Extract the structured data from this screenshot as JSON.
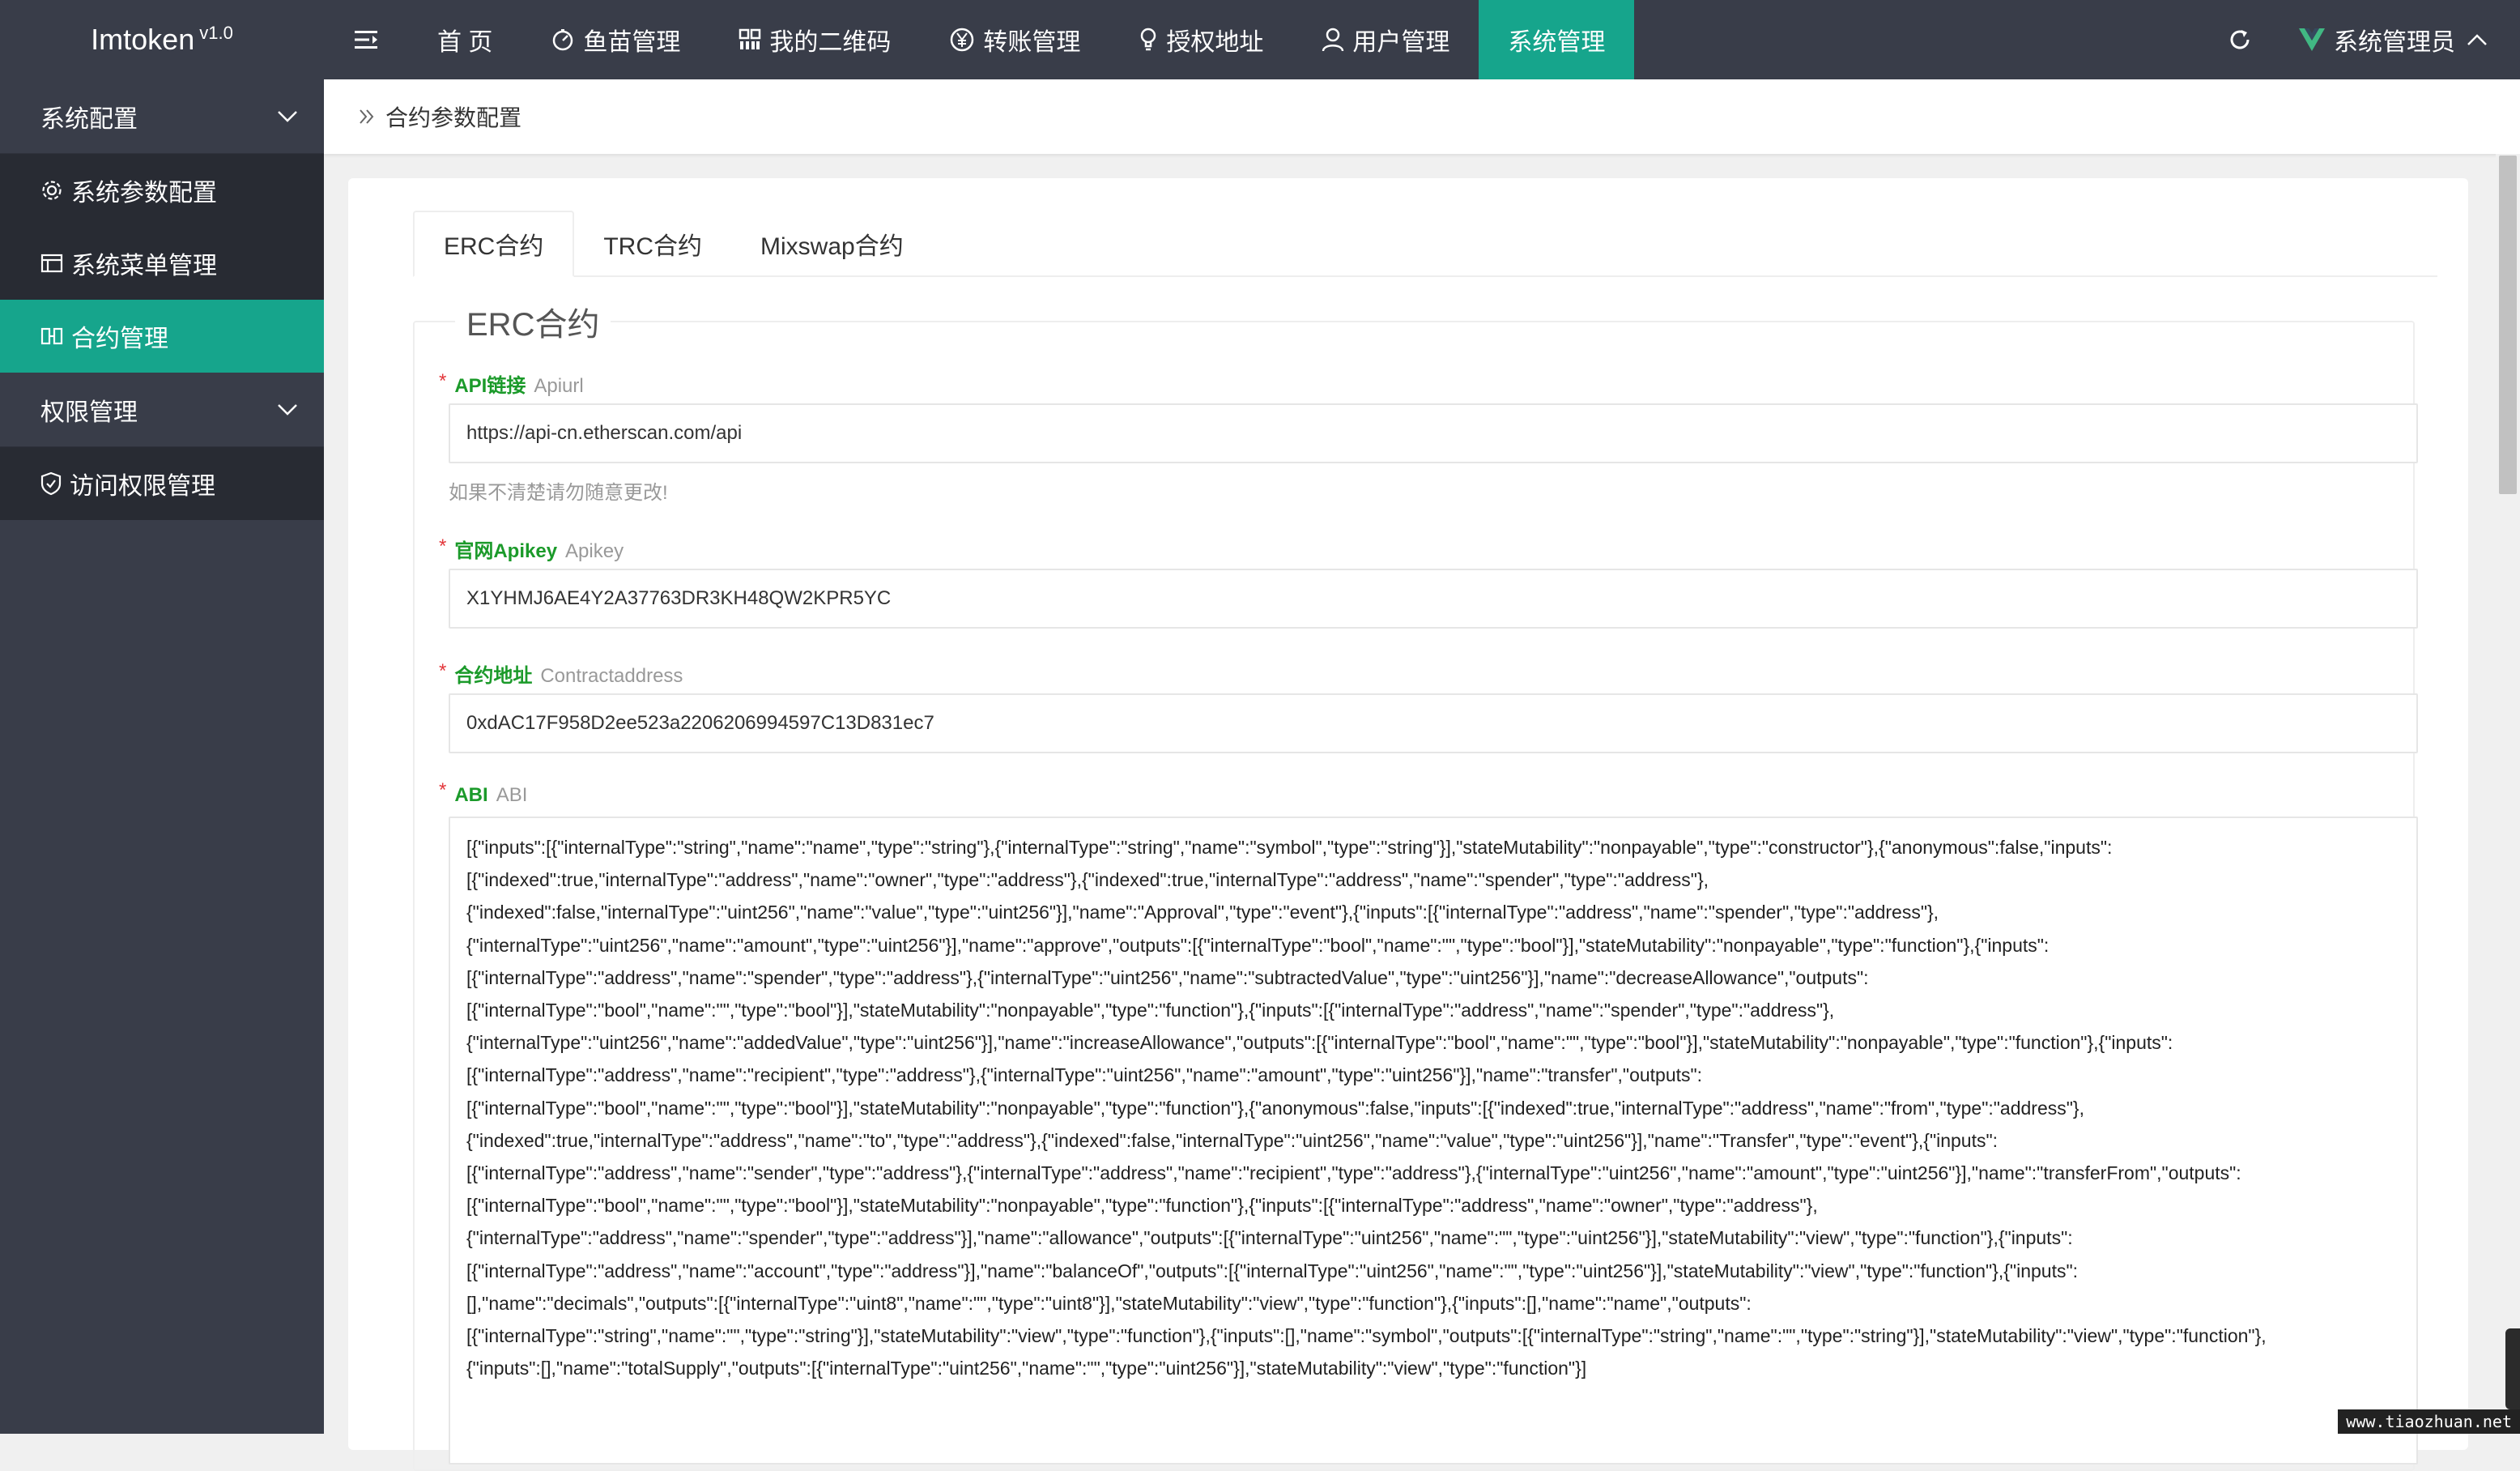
{
  "app": {
    "name": "Imtoken",
    "version": "v1.0"
  },
  "nav": {
    "items": [
      {
        "label": "首 页",
        "icon": ""
      },
      {
        "label": "鱼苗管理",
        "icon": "gauge-icon"
      },
      {
        "label": "我的二维码",
        "icon": "qrcode-icon"
      },
      {
        "label": "转账管理",
        "icon": "yen-icon"
      },
      {
        "label": "授权地址",
        "icon": "bulb-icon"
      },
      {
        "label": "用户管理",
        "icon": "user-icon"
      },
      {
        "label": "系统管理",
        "icon": ""
      }
    ],
    "active_index": 6
  },
  "user": {
    "name": "系统管理员"
  },
  "colors": {
    "accent": "#16a58c",
    "dark": "#393d49",
    "darker": "#282b33"
  },
  "sidebar": {
    "group1": {
      "label": "系统配置"
    },
    "items1": [
      {
        "label": "系统参数配置",
        "icon": "gear-icon"
      },
      {
        "label": "系统菜单管理",
        "icon": "menu-table-icon"
      },
      {
        "label": "合约管理",
        "icon": "contract-icon"
      }
    ],
    "group2": {
      "label": "权限管理"
    },
    "items2": [
      {
        "label": "访问权限管理",
        "icon": "shield-icon"
      }
    ]
  },
  "breadcrumb": {
    "title": "合约参数配置"
  },
  "tabs": [
    {
      "label": "ERC合约"
    },
    {
      "label": "TRC合约"
    },
    {
      "label": "Mixswap合约"
    }
  ],
  "form": {
    "legend": "ERC合约",
    "api": {
      "label_cn": "API链接",
      "label_en": "Apiurl",
      "value": "https://api-cn.etherscan.com/api",
      "hint": "如果不清楚请勿随意更改!"
    },
    "apikey": {
      "label_cn": "官网Apikey",
      "label_en": "Apikey",
      "value": "X1YHMJ6AE4Y2A37763DR3KH48QW2KPR5YC"
    },
    "contract": {
      "label_cn": "合约地址",
      "label_en": "Contractaddress",
      "value": "0xdAC17F958D2ee523a2206206994597C13D831ec7"
    },
    "abi": {
      "label_cn": "ABI",
      "label_en": "ABI",
      "lines": [
        "[{\"inputs\":[{\"internalType\":\"string\",\"name\":\"name\",\"type\":\"string\"},{\"internalType\":\"string\",\"name\":\"symbol\",\"type\":\"string\"}],\"stateMutability\":\"nonpayable\",\"type\":\"constructor\"},{\"anonymous\":false,\"inputs\":",
        "[{\"indexed\":true,\"internalType\":\"address\",\"name\":\"owner\",\"type\":\"address\"},{\"indexed\":true,\"internalType\":\"address\",\"name\":\"spender\",\"type\":\"address\"},",
        "{\"indexed\":false,\"internalType\":\"uint256\",\"name\":\"value\",\"type\":\"uint256\"}],\"name\":\"Approval\",\"type\":\"event\"},{\"inputs\":[{\"internalType\":\"address\",\"name\":\"spender\",\"type\":\"address\"},",
        "{\"internalType\":\"uint256\",\"name\":\"amount\",\"type\":\"uint256\"}],\"name\":\"approve\",\"outputs\":[{\"internalType\":\"bool\",\"name\":\"\",\"type\":\"bool\"}],\"stateMutability\":\"nonpayable\",\"type\":\"function\"},{\"inputs\":",
        "[{\"internalType\":\"address\",\"name\":\"spender\",\"type\":\"address\"},{\"internalType\":\"uint256\",\"name\":\"subtractedValue\",\"type\":\"uint256\"}],\"name\":\"decreaseAllowance\",\"outputs\":",
        "[{\"internalType\":\"bool\",\"name\":\"\",\"type\":\"bool\"}],\"stateMutability\":\"nonpayable\",\"type\":\"function\"},{\"inputs\":[{\"internalType\":\"address\",\"name\":\"spender\",\"type\":\"address\"},",
        "{\"internalType\":\"uint256\",\"name\":\"addedValue\",\"type\":\"uint256\"}],\"name\":\"increaseAllowance\",\"outputs\":[{\"internalType\":\"bool\",\"name\":\"\",\"type\":\"bool\"}],\"stateMutability\":\"nonpayable\",\"type\":\"function\"},{\"inputs\":",
        "[{\"internalType\":\"address\",\"name\":\"recipient\",\"type\":\"address\"},{\"internalType\":\"uint256\",\"name\":\"amount\",\"type\":\"uint256\"}],\"name\":\"transfer\",\"outputs\":",
        "[{\"internalType\":\"bool\",\"name\":\"\",\"type\":\"bool\"}],\"stateMutability\":\"nonpayable\",\"type\":\"function\"},{\"anonymous\":false,\"inputs\":[{\"indexed\":true,\"internalType\":\"address\",\"name\":\"from\",\"type\":\"address\"},",
        "{\"indexed\":true,\"internalType\":\"address\",\"name\":\"to\",\"type\":\"address\"},{\"indexed\":false,\"internalType\":\"uint256\",\"name\":\"value\",\"type\":\"uint256\"}],\"name\":\"Transfer\",\"type\":\"event\"},{\"inputs\":",
        "[{\"internalType\":\"address\",\"name\":\"sender\",\"type\":\"address\"},{\"internalType\":\"address\",\"name\":\"recipient\",\"type\":\"address\"},{\"internalType\":\"uint256\",\"name\":\"amount\",\"type\":\"uint256\"}],\"name\":\"transferFrom\",\"outputs\":",
        "[{\"internalType\":\"bool\",\"name\":\"\",\"type\":\"bool\"}],\"stateMutability\":\"nonpayable\",\"type\":\"function\"},{\"inputs\":[{\"internalType\":\"address\",\"name\":\"owner\",\"type\":\"address\"},",
        "{\"internalType\":\"address\",\"name\":\"spender\",\"type\":\"address\"}],\"name\":\"allowance\",\"outputs\":[{\"internalType\":\"uint256\",\"name\":\"\",\"type\":\"uint256\"}],\"stateMutability\":\"view\",\"type\":\"function\"},{\"inputs\":",
        "[{\"internalType\":\"address\",\"name\":\"account\",\"type\":\"address\"}],\"name\":\"balanceOf\",\"outputs\":[{\"internalType\":\"uint256\",\"name\":\"\",\"type\":\"uint256\"}],\"stateMutability\":\"view\",\"type\":\"function\"},{\"inputs\":",
        "[],\"name\":\"decimals\",\"outputs\":[{\"internalType\":\"uint8\",\"name\":\"\",\"type\":\"uint8\"}],\"stateMutability\":\"view\",\"type\":\"function\"},{\"inputs\":[],\"name\":\"name\",\"outputs\":",
        "[{\"internalType\":\"string\",\"name\":\"\",\"type\":\"string\"}],\"stateMutability\":\"view\",\"type\":\"function\"},{\"inputs\":[],\"name\":\"symbol\",\"outputs\":[{\"internalType\":\"string\",\"name\":\"\",\"type\":\"string\"}],\"stateMutability\":\"view\",\"type\":\"function\"},",
        "{\"inputs\":[],\"name\":\"totalSupply\",\"outputs\":[{\"internalType\":\"uint256\",\"name\":\"\",\"type\":\"uint256\"}],\"stateMutability\":\"view\",\"type\":\"function\"}]"
      ]
    }
  },
  "watermark": "www.tiaozhuan.net"
}
